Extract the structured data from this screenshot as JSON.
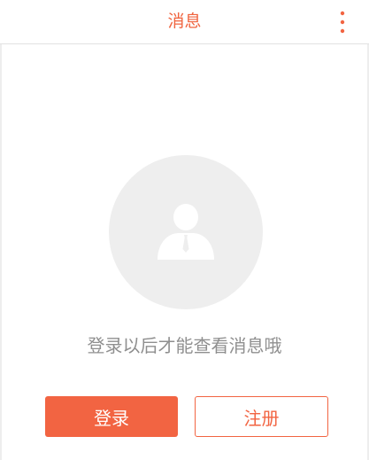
{
  "header": {
    "title": "消息",
    "more_icon": "more-vertical-icon"
  },
  "empty_state": {
    "avatar_icon": "user-icon",
    "message": "登录以后才能查看消息哦"
  },
  "actions": {
    "login_label": "登录",
    "register_label": "注册"
  },
  "colors": {
    "accent": "#f26442",
    "text_muted": "#8f8f8f",
    "avatar_bg": "#eeeeee"
  }
}
